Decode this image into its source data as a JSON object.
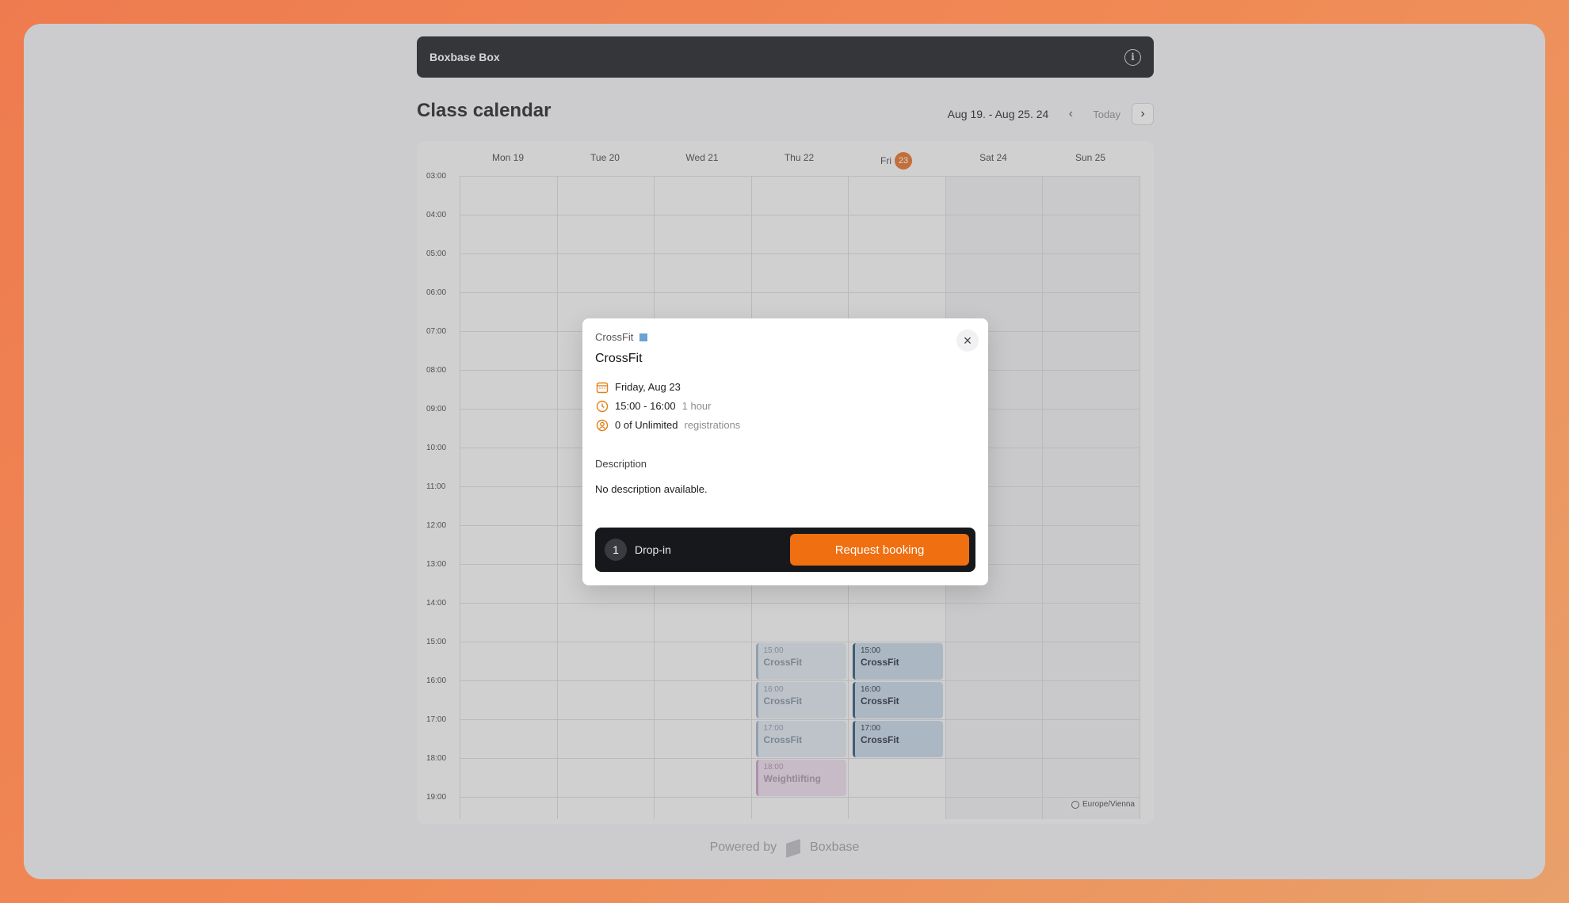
{
  "app": {
    "title": "Boxbase Box"
  },
  "page": {
    "title": "Class calendar"
  },
  "nav": {
    "range": "Aug 19. - Aug 25. 24",
    "today": "Today",
    "prev": "‹",
    "next": "›"
  },
  "days": [
    {
      "name": "Mon 19"
    },
    {
      "name": "Tue 20"
    },
    {
      "name": "Wed 21"
    },
    {
      "name": "Thu 22"
    },
    {
      "name": "Fri",
      "badge": "23"
    },
    {
      "name": "Sat 24"
    },
    {
      "name": "Sun 25"
    }
  ],
  "hours": [
    "03:00",
    "04:00",
    "05:00",
    "06:00",
    "07:00",
    "08:00",
    "09:00",
    "10:00",
    "11:00",
    "12:00",
    "13:00",
    "14:00",
    "15:00",
    "16:00",
    "17:00",
    "18:00",
    "19:00"
  ],
  "events": [
    {
      "day": 3,
      "start": "15:00",
      "time": "15:00",
      "title": "CrossFit",
      "style": "past"
    },
    {
      "day": 3,
      "start": "16:00",
      "time": "16:00",
      "title": "CrossFit",
      "style": "past"
    },
    {
      "day": 3,
      "start": "17:00",
      "time": "17:00",
      "title": "CrossFit",
      "style": "past"
    },
    {
      "day": 3,
      "start": "18:00",
      "time": "18:00",
      "title": "Weightlifting",
      "style": "wl"
    },
    {
      "day": 4,
      "start": "15:00",
      "time": "15:00",
      "title": "CrossFit",
      "style": "cur"
    },
    {
      "day": 4,
      "start": "16:00",
      "time": "16:00",
      "title": "CrossFit",
      "style": "cur"
    },
    {
      "day": 4,
      "start": "17:00",
      "time": "17:00",
      "title": "CrossFit",
      "style": "cur"
    }
  ],
  "timezone": "Europe/Vienna",
  "footer": {
    "powered": "Powered by",
    "brand": "Boxbase"
  },
  "modal": {
    "category": "CrossFit",
    "category_color": "#6aa3d1",
    "title": "CrossFit",
    "date": "Friday, Aug 23",
    "time": "15:00 - 16:00",
    "duration": "1 hour",
    "capacity": "0 of Unlimited",
    "capacity_suffix": "registrations",
    "description_heading": "Description",
    "description": "No description available.",
    "ticket_count": "1",
    "ticket_type": "Drop-in",
    "book_label": "Request booking",
    "close_label": "×"
  },
  "colors": {
    "accent": "#ef6f11",
    "today_badge": "#e66a1a",
    "topbar": "#16171b"
  }
}
